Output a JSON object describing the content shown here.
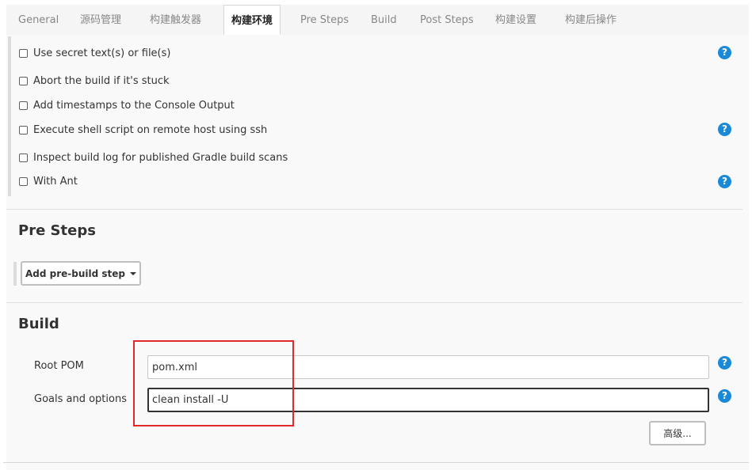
{
  "tabs": [
    {
      "label": "General",
      "active": false
    },
    {
      "label": "源码管理",
      "active": false
    },
    {
      "label": "构建触发器",
      "active": false
    },
    {
      "label": "构建环境",
      "active": true
    },
    {
      "label": "Pre Steps",
      "active": false
    },
    {
      "label": "Build",
      "active": false
    },
    {
      "label": "Post Steps",
      "active": false
    },
    {
      "label": "构建设置",
      "active": false
    },
    {
      "label": "构建后操作",
      "active": false
    }
  ],
  "build_env": {
    "options": [
      {
        "label": "Use secret text(s) or file(s)",
        "checked": false,
        "help": true
      },
      {
        "label": "Abort the build if it's stuck",
        "checked": false,
        "help": false
      },
      {
        "label": "Add timestamps to the Console Output",
        "checked": false,
        "help": false
      },
      {
        "label": "Execute shell script on remote host using ssh",
        "checked": false,
        "help": true
      },
      {
        "label": "Inspect build log for published Gradle build scans",
        "checked": false,
        "help": false
      },
      {
        "label": "With Ant",
        "checked": false,
        "help": true
      }
    ]
  },
  "pre_steps": {
    "title": "Pre Steps",
    "add_button": "Add pre-build step"
  },
  "build": {
    "title": "Build",
    "root_pom_label": "Root POM",
    "root_pom_value": "pom.xml",
    "goals_label": "Goals and options",
    "goals_value": "clean install -U",
    "advanced_button": "高级..."
  },
  "help_icon": "?",
  "colors": {
    "help_icon": "#1a8ad8",
    "annotation": "#e02a2a"
  }
}
